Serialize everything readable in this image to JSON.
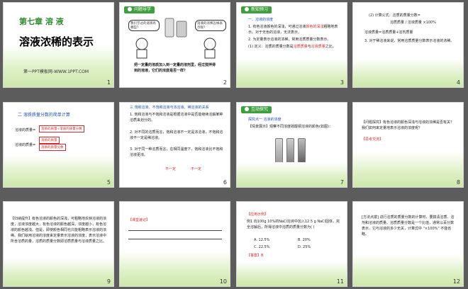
{
  "slides": [
    {
      "num": "1",
      "chapter": "第七章  溶  液",
      "title": "溶液浓稀的表示",
      "footer": "第一PPT模板网-WWW.1PPT.COM"
    },
    {
      "num": "2",
      "tag": "问题导学",
      "bubble1": "我们学过的溶液有哪些？",
      "bubble2": "溶液的浓稀怎样表示呢？",
      "caption": "把一定量的溶质加入到一定量的溶剂里，经过搅拌得到的溶液，它们的浓度是否一样？"
    },
    {
      "num": "3",
      "tag": "新知预习",
      "h1": "一、溶液的浓度",
      "p1": "1. 有色溶液颜色的深浅，可通过溶液",
      "p1hl": "颜色的深浅",
      "p1b": "粗略地表示。对于无色的溶液，无法表示。",
      "p2": "2. 为定量表示溶液的浓稀，常用溶质质量分数表示。",
      "p3": "(1) 定义：溶质的质量分数是",
      "p3hl": "溶质质量",
      "p3b": "与",
      "p3hl2": "溶液质量",
      "p3c": "之比。"
    },
    {
      "num": "4",
      "p1": "(2) 计算公式：溶质的质量分数=",
      "frac": "溶质质量 / 溶液质量 ×100%",
      "p2": "溶液质量=溶质质量+溶剂质量",
      "p3": "3. 对于稀溶液来说，常用溶质质量分数表示溶液的浓稀。"
    },
    {
      "num": "5",
      "h1": "二  溶质质量分数的简单计算",
      "l1": "溶液的质量=",
      "b1": "溶质的质量÷溶质的质量分数",
      "l2": "溶液的质量=",
      "b2": "溶质的质量",
      "b3": "溶质的质量分数"
    },
    {
      "num": "6",
      "h1": "三  饱和溶液、不饱和溶液与浓溶液、稀溶液的关系",
      "p1": "1. 饱和溶液与不饱和溶液是根据溶液中是否能继续溶解某种溶质来划分的。",
      "p2": "2. 对不同的溶质而言，饱和溶液不一定是浓溶液，不饱和溶液不一定是稀溶液。",
      "p3": "3. 对于同一种溶质而言，在相同温度下，饱和溶液比不饱和溶液更浓。",
      "w1": "不一定",
      "w2": "不一定"
    },
    {
      "num": "7",
      "tag": "互动探究",
      "h1": "探究点一  溶液的浓度",
      "p1": "【情景展示】观察不同浓度硫酸铜溶液的颜色(如图)："
    },
    {
      "num": "8",
      "p1": "【问题探究】有色溶液的颜色深浅与溶液的浓稀是否有关？我们如何来定量地表示溶液的浓度呢？",
      "p2": "【思考交流】"
    },
    {
      "num": "9",
      "p1": "【归纳提升】有色溶液的颜色的深浅，可粗略地反映溶液的浓度，溶液浓度越大，有色溶液的颜色越深。浓度越小，有色溶液的颜色越浅。但是，即使颜色相同也只能粗略表示溶液的浓稀。我们就用溶液的浓度来定量表示溶液的浓度，表示溶液中所含溶质的量，溶质的质量分数即溶质质量与溶液质量之比。"
    },
    {
      "num": "10",
      "p1": "【课堂速记】"
    },
    {
      "num": "11",
      "p1": "【应用示例】",
      "p2": "例1  向100g 10%的NaCl溶液中加入12.5 g NaCl固体，完全溶解后，所得溶液中溶质的质量分数为(  )",
      "a": "A. 12.5%",
      "b": "B. 20%",
      "c": "C. 22.5%",
      "d": "D. 25%",
      "ans": "【答案】B"
    },
    {
      "num": "12",
      "p1": "[方法点拨] 进行溶质的质量分数的计算时，要搞清溶质、溶剂和溶液的质量。溶质质量分数是一个比值，通常以百分数表示，它与溶液的多少无关，计算式中 \"×100%\" 不能省略。"
    }
  ],
  "colors": {
    "accent": "#3e9f3e",
    "highlight": "#d62828",
    "selection": "#f3c23a",
    "background": "#5c5c5c"
  }
}
